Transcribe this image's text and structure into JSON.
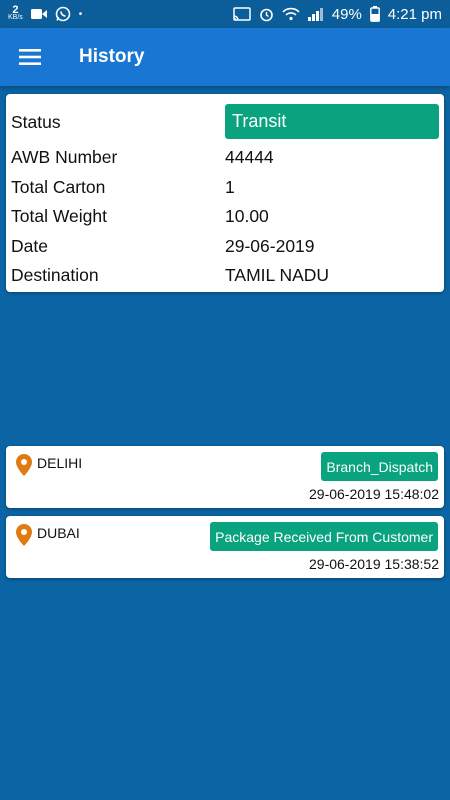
{
  "status_bar": {
    "data_rate_value": "2",
    "data_rate_unit": "KB/s",
    "battery": "49%",
    "time": "4:21 pm"
  },
  "app_bar": {
    "title": "History",
    "menu_icon": "hamburger-menu-icon"
  },
  "details": {
    "status_label": "Status",
    "status_value": "Transit",
    "rows": [
      {
        "label": "AWB Number",
        "value": "44444"
      },
      {
        "label": "Total Carton",
        "value": "1"
      },
      {
        "label": "Total Weight",
        "value": "10.00"
      },
      {
        "label": "Date",
        "value": "29-06-2019"
      },
      {
        "label": "Destination",
        "value": "TAMIL NADU"
      }
    ]
  },
  "history": [
    {
      "location": "DELIHI",
      "status": "Branch_Dispatch",
      "timestamp": "29-06-2019 15:48:02"
    },
    {
      "location": "DUBAI",
      "status": "Package Received From Customer",
      "timestamp": "29-06-2019 15:38:52"
    }
  ],
  "colors": {
    "background": "#0b64a3",
    "app_bar": "#1976d2",
    "status_green": "#0aa37f",
    "pin_orange": "#e07b13"
  }
}
